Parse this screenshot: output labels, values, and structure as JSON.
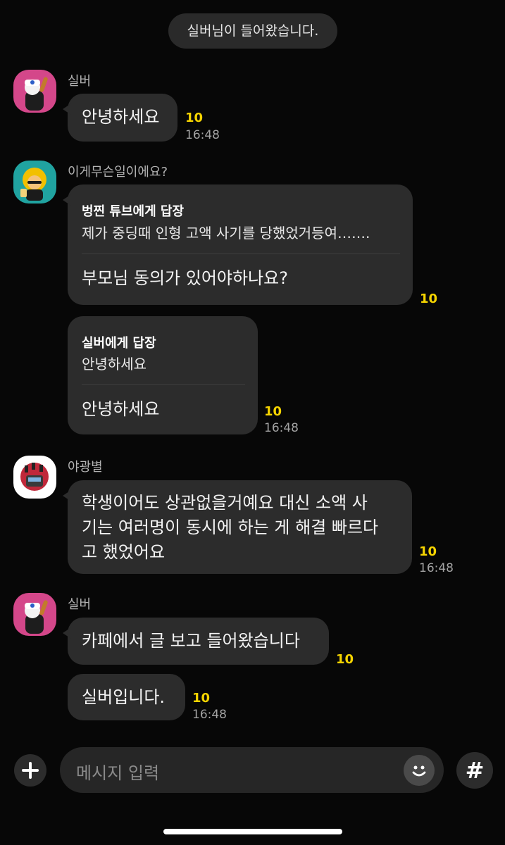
{
  "notice": "실버님이 들어왔습니다.",
  "messages": [
    {
      "sender": "실버",
      "text": "안녕하세요",
      "unread": "10",
      "time": "16:48"
    },
    {
      "sender": "이게무슨일이에요?",
      "reply_title": "벙찐 튜브에게 답장",
      "reply_quote": "제가 중딩때 인형 고액 사기를 당했었거등여…….",
      "text": "부모님 동의가 있어야하나요?",
      "unread": "10"
    },
    {
      "reply_title": "실버에게 답장",
      "reply_quote": "안녕하세요",
      "text": "안녕하세요",
      "unread": "10",
      "time": "16:48"
    },
    {
      "sender": "야광별",
      "lines": [
        "학생이어도 상관없을거예요 대신 소액 사",
        "기는 여러명이 동시에 하는 게 해결 빠르다",
        "고 했었어요"
      ],
      "unread": "10",
      "time": "16:48"
    },
    {
      "sender": "실버",
      "text": "카페에서 글 보고 들어왔습니다",
      "unread": "10"
    },
    {
      "text": "실버입니다.",
      "unread": "10",
      "time": "16:48"
    }
  ],
  "input": {
    "placeholder": "메시지 입력",
    "hash_label": "#"
  },
  "icons": [
    "plus-icon",
    "emoji-icon",
    "hashtag-icon"
  ],
  "colors": {
    "background": "#070707",
    "bubble": "#2c2c2c",
    "unread": "#f5d400"
  }
}
